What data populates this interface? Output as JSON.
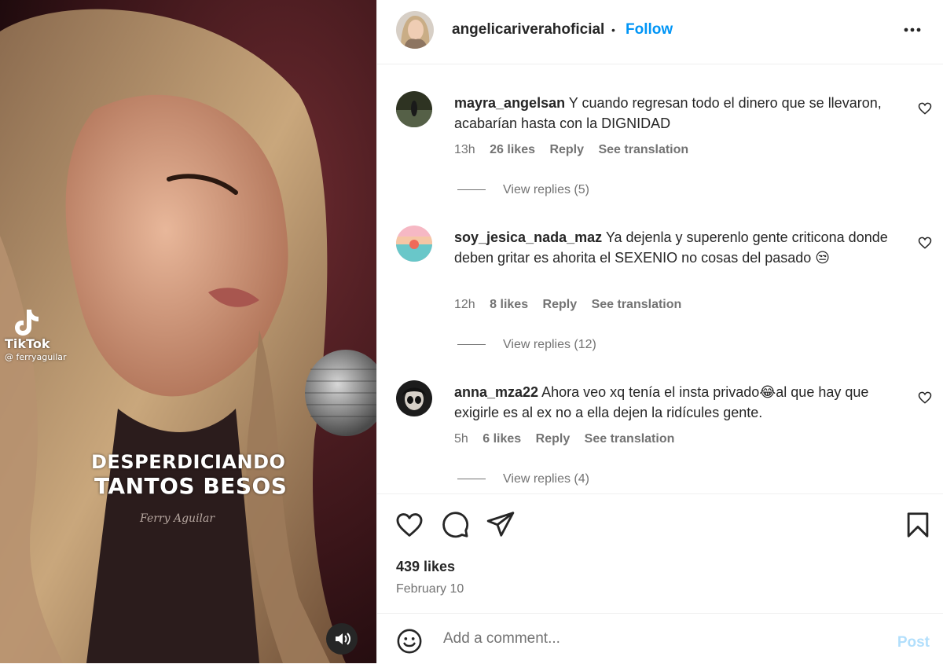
{
  "media": {
    "overlay_line1": "DESPERDICIANDO",
    "overlay_line2": "TANTOS BESOS",
    "watermark_brand": "TikTok",
    "watermark_handle": "@ ferryaguilar",
    "signature": "Ferry Aguilar",
    "sound_icon": "speaker-icon"
  },
  "header": {
    "username": "angelicariverahoficial",
    "separator": "•",
    "follow_label": "Follow",
    "more_icon": "more-icon"
  },
  "comments": [
    {
      "username": "mayra_angelsan",
      "text": "Y cuando regresan todo el dinero que se llevaron, acabarían hasta con la DIGNIDAD",
      "time": "13h",
      "likes": "26 likes",
      "reply": "Reply",
      "translate": "See translation",
      "view_replies": "View replies (5)"
    },
    {
      "username": "soy_jesica_nada_maz",
      "text": "Ya dejenla y superenlo gente criticona donde deben gritar es ahorita el SEXENIO no cosas del pasado 😒",
      "time": "12h",
      "likes": "8 likes",
      "reply": "Reply",
      "translate": "See translation",
      "view_replies": "View replies (12)"
    },
    {
      "username": "anna_mza22",
      "text": "Ahora veo xq tenía el insta privado😂al que hay que exigirle es al ex no a ella dejen la ridícules gente.",
      "time": "5h",
      "likes": "6 likes",
      "reply": "Reply",
      "translate": "See translation",
      "view_replies": "View replies (4)"
    }
  ],
  "actions": {
    "likes": "439 likes",
    "date": "February 10"
  },
  "add_comment": {
    "placeholder": "Add a comment...",
    "post_label": "Post"
  },
  "colors": {
    "accent": "#0095f6",
    "post_disabled": "#b2dffc",
    "muted_text": "#737373",
    "border": "#efefef"
  }
}
